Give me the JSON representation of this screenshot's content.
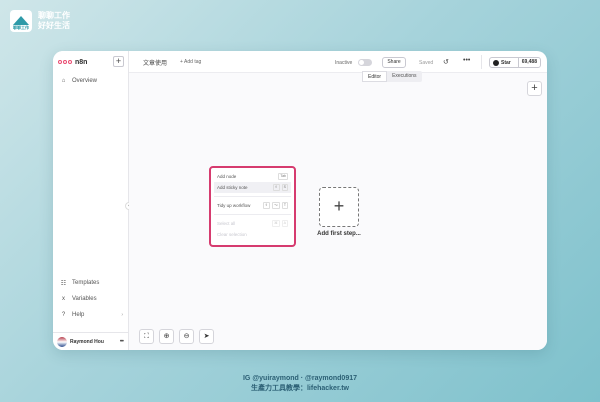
{
  "brand": {
    "logo_caption": "聊聊工作",
    "line1": "聊聊工作",
    "line2": "好好生活"
  },
  "sidebar": {
    "logo_text": "n8n",
    "new_label": "+",
    "collapse_icon": "‹",
    "items": [
      {
        "icon": "⌂",
        "label": "Overview"
      }
    ],
    "bottom_items": [
      {
        "icon": "☷",
        "label": "Templates"
      },
      {
        "icon": "x",
        "label": "Variables"
      },
      {
        "icon": "?",
        "label": "Help",
        "chevron": "›"
      }
    ],
    "user": {
      "name": "Raymond Hou",
      "more": "•••"
    }
  },
  "topbar": {
    "workflow_name": "文章使用",
    "add_tag": "+ Add tag",
    "status_label": "Inactive",
    "share_label": "Share",
    "saved_label": "Saved",
    "history_icon": "↺",
    "more_icon": "•••",
    "star_label": "Star",
    "star_count": "69,488",
    "tabs": [
      {
        "label": "Editor",
        "active": true
      },
      {
        "label": "Executions",
        "active": false
      }
    ]
  },
  "canvas": {
    "corner_plus": "+",
    "context_menu": [
      {
        "label": "Add node",
        "keys": [
          "Tab"
        ],
        "state": "normal"
      },
      {
        "label": "Add sticky note",
        "keys": [
          "⇧",
          "S"
        ],
        "state": "hover"
      },
      {
        "label": "Tidy up workflow",
        "keys": [
          "⇧",
          "⌥",
          "T"
        ],
        "state": "normal",
        "sep_before": true
      },
      {
        "label": "Select all",
        "keys": [
          "⌘",
          "A"
        ],
        "state": "disabled",
        "sep_before": true
      },
      {
        "label": "Clear selection",
        "keys": [],
        "state": "disabled"
      }
    ],
    "add_first_step": "Add first step...",
    "add_first_step_icon": "+",
    "zoom_buttons": [
      "⛶",
      "⊕",
      "⊖",
      "➤"
    ]
  },
  "caption": {
    "line1": "IG @yuiraymond · @raymond0917",
    "line2": "生產力工具教學：lifehacker.tw"
  },
  "colors": {
    "accent": "#d63b6f",
    "n8n_brand": "#ea4b71",
    "background_teal": "#7ec1cc"
  }
}
